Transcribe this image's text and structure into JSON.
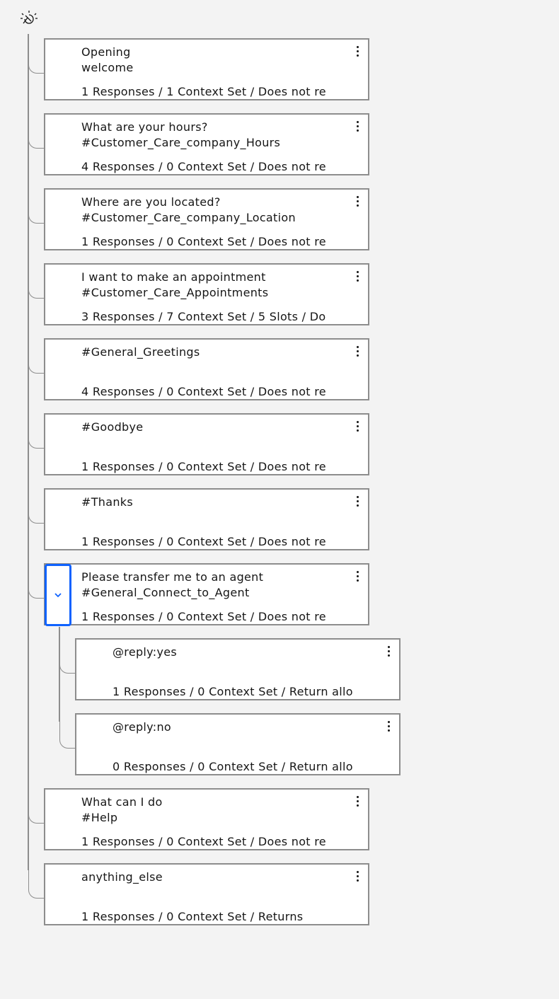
{
  "app": {
    "logo_icon": "watson-logo-icon",
    "accent_color": "#0f62fe",
    "border_color": "#8d8d8d"
  },
  "nodes": [
    {
      "title": "Opening",
      "condition": "welcome",
      "summary": "1 Responses / 1 Context Set / Does not re"
    },
    {
      "title": "What are your hours?",
      "condition": "#Customer_Care_company_Hours",
      "summary": "4 Responses / 0 Context Set / Does not re"
    },
    {
      "title": "Where are you located?",
      "condition": "#Customer_Care_company_Location",
      "summary": "1 Responses / 0 Context Set / Does not re"
    },
    {
      "title": "I want to make an appointment",
      "condition": "#Customer_Care_Appointments",
      "summary": "3 Responses / 7 Context Set / 5 Slots / Do"
    },
    {
      "title": "#General_Greetings",
      "condition": "",
      "summary": "4 Responses / 0 Context Set / Does not re"
    },
    {
      "title": "#Goodbye",
      "condition": "",
      "summary": "1 Responses / 0 Context Set / Does not re"
    },
    {
      "title": "#Thanks",
      "condition": "",
      "summary": "1 Responses / 0 Context Set / Does not re"
    },
    {
      "title": "Please transfer me to an agent",
      "condition": "#General_Connect_to_Agent",
      "summary": "1 Responses / 0 Context Set / Does not re"
    },
    {
      "title": "@reply:yes",
      "condition": "",
      "summary": "1 Responses / 0 Context Set / Return allo"
    },
    {
      "title": "@reply:no",
      "condition": "",
      "summary": "0 Responses / 0 Context Set / Return allo"
    },
    {
      "title": "What can I do",
      "condition": "#Help",
      "summary": "1 Responses / 0 Context Set / Does not re"
    },
    {
      "title": "anything_else",
      "condition": "",
      "summary": "1 Responses / 0 Context Set / Returns"
    }
  ],
  "expand_icon": "chevron-down-icon",
  "more_icon": "overflow-menu-icon"
}
